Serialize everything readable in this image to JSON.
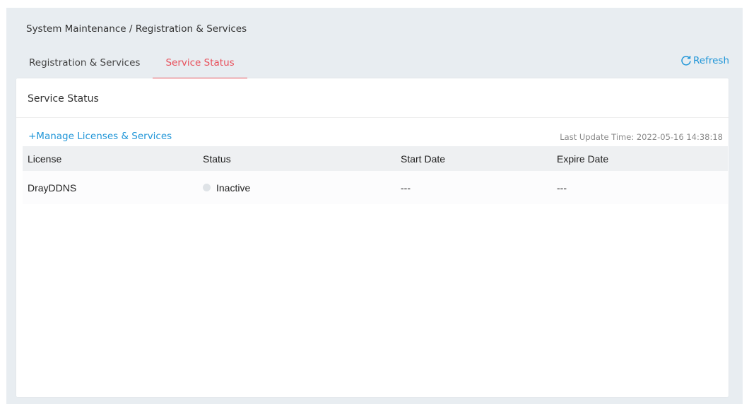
{
  "breadcrumb": "System Maintenance / Registration & Services",
  "tabs": [
    {
      "label": "Registration & Services",
      "active": false
    },
    {
      "label": "Service Status",
      "active": true
    }
  ],
  "refresh": {
    "label": "Refresh",
    "icon": "refresh-icon"
  },
  "panel": {
    "title": "Service Status",
    "manage_link": "+Manage Licenses & Services",
    "last_update": "Last Update Time: 2022-05-16 14:38:18"
  },
  "table": {
    "headers": [
      "License",
      "Status",
      "Start Date",
      "Expire Date"
    ],
    "rows": [
      {
        "license": "DrayDDNS",
        "status": "Inactive",
        "status_color": "#dfe3e7",
        "start_date": "---",
        "expire_date": "---"
      }
    ]
  },
  "colors": {
    "accent": "#e8505b",
    "link": "#2196d8",
    "background": "#e8edf1"
  }
}
